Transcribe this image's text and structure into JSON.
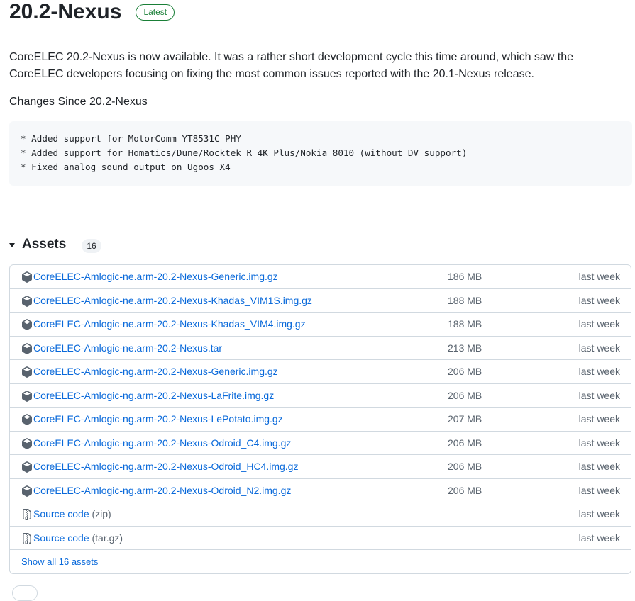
{
  "release": {
    "title": "20.2-Nexus",
    "badge": "Latest",
    "intro": "CoreELEC 20.2-Nexus is now available. It was a rather short development cycle this time around, which saw the CoreELEC developers focusing on fixing the most common issues reported with the 20.1-Nexus release.",
    "changes_heading": "Changes Since 20.2-Nexus",
    "changelog": [
      "* Added support for MotorComm YT8531C PHY",
      "* Added support for Homatics/Dune/Rocktek R 4K Plus/Nokia 8010 (without DV support)",
      "* Fixed analog sound output on Ugoos X4"
    ]
  },
  "assets": {
    "title": "Assets",
    "count": "16",
    "items": [
      {
        "name": "CoreELEC-Amlogic-ne.arm-20.2-Nexus-Generic.img.gz",
        "size": "186 MB",
        "date": "last week",
        "icon": "package-icon"
      },
      {
        "name": "CoreELEC-Amlogic-ne.arm-20.2-Nexus-Khadas_VIM1S.img.gz",
        "size": "188 MB",
        "date": "last week",
        "icon": "package-icon"
      },
      {
        "name": "CoreELEC-Amlogic-ne.arm-20.2-Nexus-Khadas_VIM4.img.gz",
        "size": "188 MB",
        "date": "last week",
        "icon": "package-icon"
      },
      {
        "name": "CoreELEC-Amlogic-ne.arm-20.2-Nexus.tar",
        "size": "213 MB",
        "date": "last week",
        "icon": "package-icon"
      },
      {
        "name": "CoreELEC-Amlogic-ng.arm-20.2-Nexus-Generic.img.gz",
        "size": "206 MB",
        "date": "last week",
        "icon": "package-icon"
      },
      {
        "name": "CoreELEC-Amlogic-ng.arm-20.2-Nexus-LaFrite.img.gz",
        "size": "206 MB",
        "date": "last week",
        "icon": "package-icon"
      },
      {
        "name": "CoreELEC-Amlogic-ng.arm-20.2-Nexus-LePotato.img.gz",
        "size": "207 MB",
        "date": "last week",
        "icon": "package-icon"
      },
      {
        "name": "CoreELEC-Amlogic-ng.arm-20.2-Nexus-Odroid_C4.img.gz",
        "size": "206 MB",
        "date": "last week",
        "icon": "package-icon"
      },
      {
        "name": "CoreELEC-Amlogic-ng.arm-20.2-Nexus-Odroid_HC4.img.gz",
        "size": "206 MB",
        "date": "last week",
        "icon": "package-icon"
      },
      {
        "name": "CoreELEC-Amlogic-ng.arm-20.2-Nexus-Odroid_N2.img.gz",
        "size": "206 MB",
        "date": "last week",
        "icon": "package-icon"
      }
    ],
    "source": [
      {
        "name": "Source code",
        "suffix": "(zip)",
        "date": "last week",
        "icon": "file-zip-icon"
      },
      {
        "name": "Source code",
        "suffix": "(tar.gz)",
        "date": "last week",
        "icon": "file-zip-icon"
      }
    ],
    "show_all": "Show all 16 assets"
  },
  "colors": {
    "link": "#0969da",
    "muted": "#59636e",
    "latest": "#1a7f37",
    "border": "#d1d9e0"
  }
}
